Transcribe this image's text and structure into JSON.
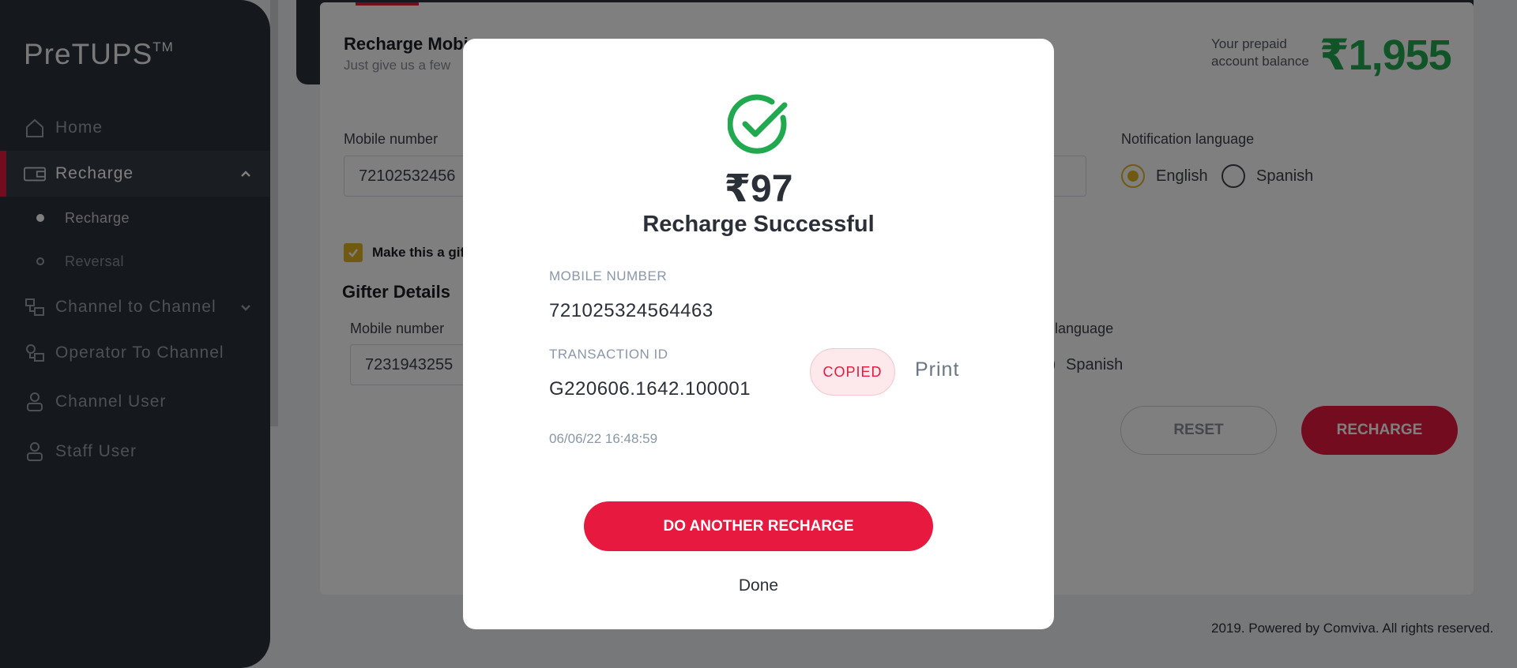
{
  "sidebar": {
    "logo": "PreTUPS",
    "logo_tm": "TM",
    "items": [
      {
        "label": "Home",
        "icon": "home-icon"
      },
      {
        "label": "Recharge",
        "icon": "wallet-icon"
      },
      {
        "label": "Channel to Channel",
        "icon": "transfer-icon"
      },
      {
        "label": "Operator To Channel",
        "icon": "transfer-icon"
      },
      {
        "label": "Channel User",
        "icon": "user-icon"
      },
      {
        "label": "Staff User",
        "icon": "user-icon"
      }
    ],
    "recharge_sub": [
      {
        "label": "Recharge"
      },
      {
        "label": "Reversal"
      }
    ]
  },
  "main": {
    "title": "Recharge Mobi",
    "subtitle": "Just give us a few",
    "balance_label_1": "Your prepaid",
    "balance_label_2": "account balance",
    "balance_value": "₹1,955",
    "mobile_label": "Mobile number",
    "mobile_value": "72102532456",
    "notif_label": "Notification language",
    "lang_english": "English",
    "lang_spanish": "Spanish",
    "gift_label": "Make this a gif",
    "gifter_title": "Gifter Details",
    "gifter_mobile_label": "Mobile number",
    "gifter_mobile_value": "7231943255",
    "gifter_notif_label": "n language",
    "gifter_lang_spanish": "Spanish",
    "reset_label": "RESET",
    "recharge_label": "RECHARGE",
    "footer": "2019. Powered by Comviva. All rights reserved."
  },
  "modal": {
    "amount": "₹97",
    "status": "Recharge Successful",
    "mobile_label": "MOBILE NUMBER",
    "mobile_value": "721025324564463",
    "txn_label": "TRANSACTION ID",
    "txn_value": "G220606.1642.100001",
    "copied_label": "COPIED",
    "print_label": "Print",
    "timestamp": "06/06/22 16:48:59",
    "another_label": "DO ANOTHER RECHARGE",
    "done_label": "Done"
  },
  "colors": {
    "accent": "#e8193f",
    "success": "#21a94f",
    "sidebar_bg": "#2b3038",
    "radio_active": "#e1b424"
  }
}
